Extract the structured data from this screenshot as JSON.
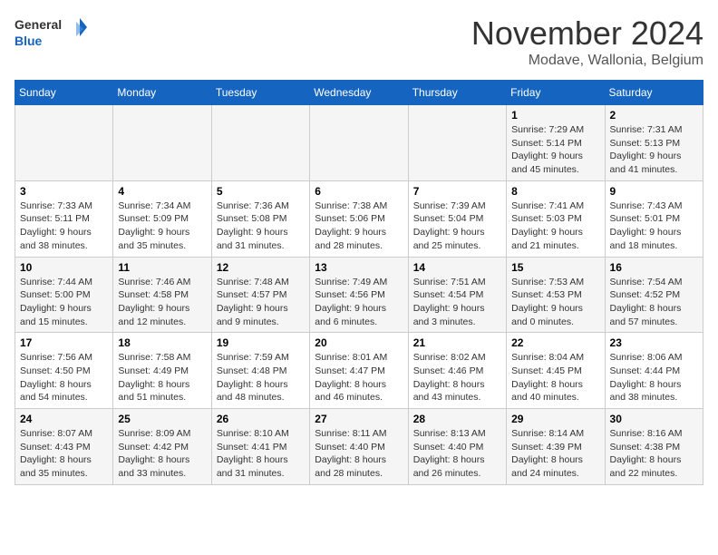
{
  "logo": {
    "line1": "General",
    "line2": "Blue"
  },
  "title": "November 2024",
  "subtitle": "Modave, Wallonia, Belgium",
  "days_of_week": [
    "Sunday",
    "Monday",
    "Tuesday",
    "Wednesday",
    "Thursday",
    "Friday",
    "Saturday"
  ],
  "weeks": [
    [
      {
        "day": "",
        "sunrise": "",
        "sunset": "",
        "daylight": ""
      },
      {
        "day": "",
        "sunrise": "",
        "sunset": "",
        "daylight": ""
      },
      {
        "day": "",
        "sunrise": "",
        "sunset": "",
        "daylight": ""
      },
      {
        "day": "",
        "sunrise": "",
        "sunset": "",
        "daylight": ""
      },
      {
        "day": "",
        "sunrise": "",
        "sunset": "",
        "daylight": ""
      },
      {
        "day": "1",
        "sunrise": "Sunrise: 7:29 AM",
        "sunset": "Sunset: 5:14 PM",
        "daylight": "Daylight: 9 hours and 45 minutes."
      },
      {
        "day": "2",
        "sunrise": "Sunrise: 7:31 AM",
        "sunset": "Sunset: 5:13 PM",
        "daylight": "Daylight: 9 hours and 41 minutes."
      }
    ],
    [
      {
        "day": "3",
        "sunrise": "Sunrise: 7:33 AM",
        "sunset": "Sunset: 5:11 PM",
        "daylight": "Daylight: 9 hours and 38 minutes."
      },
      {
        "day": "4",
        "sunrise": "Sunrise: 7:34 AM",
        "sunset": "Sunset: 5:09 PM",
        "daylight": "Daylight: 9 hours and 35 minutes."
      },
      {
        "day": "5",
        "sunrise": "Sunrise: 7:36 AM",
        "sunset": "Sunset: 5:08 PM",
        "daylight": "Daylight: 9 hours and 31 minutes."
      },
      {
        "day": "6",
        "sunrise": "Sunrise: 7:38 AM",
        "sunset": "Sunset: 5:06 PM",
        "daylight": "Daylight: 9 hours and 28 minutes."
      },
      {
        "day": "7",
        "sunrise": "Sunrise: 7:39 AM",
        "sunset": "Sunset: 5:04 PM",
        "daylight": "Daylight: 9 hours and 25 minutes."
      },
      {
        "day": "8",
        "sunrise": "Sunrise: 7:41 AM",
        "sunset": "Sunset: 5:03 PM",
        "daylight": "Daylight: 9 hours and 21 minutes."
      },
      {
        "day": "9",
        "sunrise": "Sunrise: 7:43 AM",
        "sunset": "Sunset: 5:01 PM",
        "daylight": "Daylight: 9 hours and 18 minutes."
      }
    ],
    [
      {
        "day": "10",
        "sunrise": "Sunrise: 7:44 AM",
        "sunset": "Sunset: 5:00 PM",
        "daylight": "Daylight: 9 hours and 15 minutes."
      },
      {
        "day": "11",
        "sunrise": "Sunrise: 7:46 AM",
        "sunset": "Sunset: 4:58 PM",
        "daylight": "Daylight: 9 hours and 12 minutes."
      },
      {
        "day": "12",
        "sunrise": "Sunrise: 7:48 AM",
        "sunset": "Sunset: 4:57 PM",
        "daylight": "Daylight: 9 hours and 9 minutes."
      },
      {
        "day": "13",
        "sunrise": "Sunrise: 7:49 AM",
        "sunset": "Sunset: 4:56 PM",
        "daylight": "Daylight: 9 hours and 6 minutes."
      },
      {
        "day": "14",
        "sunrise": "Sunrise: 7:51 AM",
        "sunset": "Sunset: 4:54 PM",
        "daylight": "Daylight: 9 hours and 3 minutes."
      },
      {
        "day": "15",
        "sunrise": "Sunrise: 7:53 AM",
        "sunset": "Sunset: 4:53 PM",
        "daylight": "Daylight: 9 hours and 0 minutes."
      },
      {
        "day": "16",
        "sunrise": "Sunrise: 7:54 AM",
        "sunset": "Sunset: 4:52 PM",
        "daylight": "Daylight: 8 hours and 57 minutes."
      }
    ],
    [
      {
        "day": "17",
        "sunrise": "Sunrise: 7:56 AM",
        "sunset": "Sunset: 4:50 PM",
        "daylight": "Daylight: 8 hours and 54 minutes."
      },
      {
        "day": "18",
        "sunrise": "Sunrise: 7:58 AM",
        "sunset": "Sunset: 4:49 PM",
        "daylight": "Daylight: 8 hours and 51 minutes."
      },
      {
        "day": "19",
        "sunrise": "Sunrise: 7:59 AM",
        "sunset": "Sunset: 4:48 PM",
        "daylight": "Daylight: 8 hours and 48 minutes."
      },
      {
        "day": "20",
        "sunrise": "Sunrise: 8:01 AM",
        "sunset": "Sunset: 4:47 PM",
        "daylight": "Daylight: 8 hours and 46 minutes."
      },
      {
        "day": "21",
        "sunrise": "Sunrise: 8:02 AM",
        "sunset": "Sunset: 4:46 PM",
        "daylight": "Daylight: 8 hours and 43 minutes."
      },
      {
        "day": "22",
        "sunrise": "Sunrise: 8:04 AM",
        "sunset": "Sunset: 4:45 PM",
        "daylight": "Daylight: 8 hours and 40 minutes."
      },
      {
        "day": "23",
        "sunrise": "Sunrise: 8:06 AM",
        "sunset": "Sunset: 4:44 PM",
        "daylight": "Daylight: 8 hours and 38 minutes."
      }
    ],
    [
      {
        "day": "24",
        "sunrise": "Sunrise: 8:07 AM",
        "sunset": "Sunset: 4:43 PM",
        "daylight": "Daylight: 8 hours and 35 minutes."
      },
      {
        "day": "25",
        "sunrise": "Sunrise: 8:09 AM",
        "sunset": "Sunset: 4:42 PM",
        "daylight": "Daylight: 8 hours and 33 minutes."
      },
      {
        "day": "26",
        "sunrise": "Sunrise: 8:10 AM",
        "sunset": "Sunset: 4:41 PM",
        "daylight": "Daylight: 8 hours and 31 minutes."
      },
      {
        "day": "27",
        "sunrise": "Sunrise: 8:11 AM",
        "sunset": "Sunset: 4:40 PM",
        "daylight": "Daylight: 8 hours and 28 minutes."
      },
      {
        "day": "28",
        "sunrise": "Sunrise: 8:13 AM",
        "sunset": "Sunset: 4:40 PM",
        "daylight": "Daylight: 8 hours and 26 minutes."
      },
      {
        "day": "29",
        "sunrise": "Sunrise: 8:14 AM",
        "sunset": "Sunset: 4:39 PM",
        "daylight": "Daylight: 8 hours and 24 minutes."
      },
      {
        "day": "30",
        "sunrise": "Sunrise: 8:16 AM",
        "sunset": "Sunset: 4:38 PM",
        "daylight": "Daylight: 8 hours and 22 minutes."
      }
    ]
  ]
}
